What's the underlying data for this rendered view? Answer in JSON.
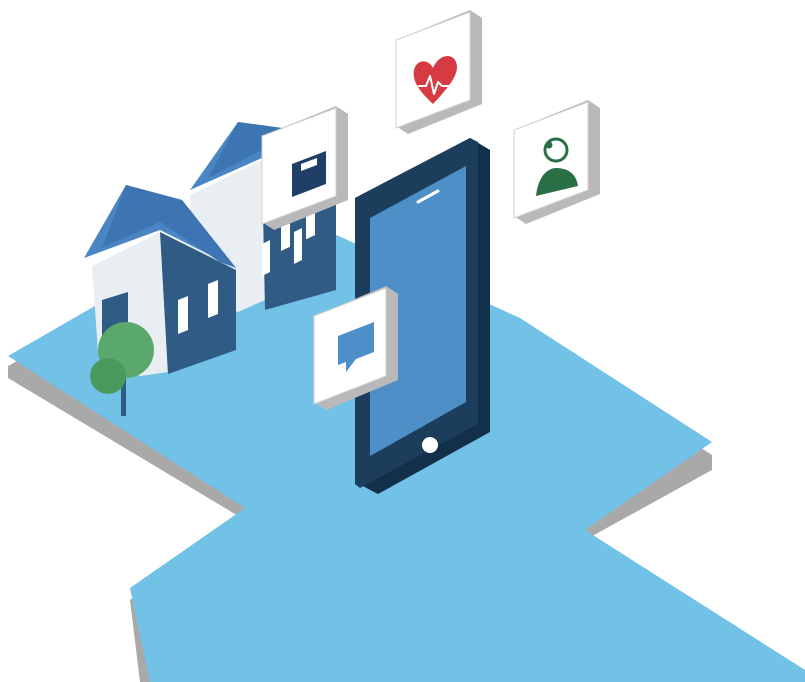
{
  "colors": {
    "background": "#ffffff",
    "platform_top": "#72c2e8",
    "platform_edge": "#b4b4b4",
    "platform_edge_dark": "#8e8e8e",
    "house_roof": "#4a86c4",
    "house_front": "#2f5b84",
    "house_wall_light": "#e9eef2",
    "window": "#ffffff",
    "phone_body": "#1c3d5c",
    "phone_screen": "#4d8fc6",
    "tile_face": "#ffffff",
    "tile_edge": "#b9b9b9",
    "heart": "#d63b43",
    "scale_icon": "#1f3f66",
    "doctor_icon": "#2a7046",
    "chat_icon": "#4d8fc6",
    "tree_leaf": "#5aa86b",
    "tree_leaf_dark": "#3f8f55",
    "tree_trunk": "#2f5b84"
  },
  "icons": [
    "heart-rate-icon",
    "weighing-scale-icon",
    "doctor-icon",
    "chat-bubble-icon"
  ]
}
